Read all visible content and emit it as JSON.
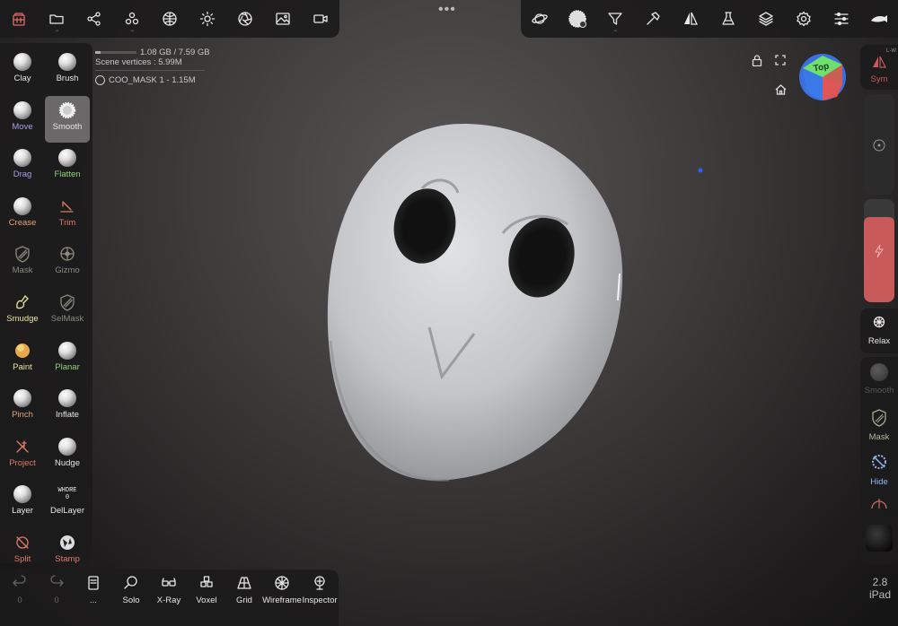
{
  "topbar_left": {
    "icons": [
      "app-logo-icon",
      "folder-icon",
      "share-icon",
      "scene-icon",
      "globe-icon",
      "sun-icon",
      "aperture-icon",
      "image-icon",
      "camera-icon"
    ]
  },
  "topbar_right": {
    "icons": [
      "planet-icon",
      "brush-sphere-icon",
      "filter-icon",
      "hammer-icon",
      "symmetry-icon",
      "flask-icon",
      "layers-icon",
      "gear-icon",
      "sliders-icon",
      "fish-icon"
    ]
  },
  "scene_info": {
    "memory": "1.08 GB / 7.59 GB",
    "memory_fraction": 0.14,
    "vertices": "Scene vertices : 5.99M",
    "object": "COO_MASK 1 - 1.15M"
  },
  "tools": [
    {
      "label": "Clay",
      "color": "#e6e6e6",
      "icon": "sphere"
    },
    {
      "label": "Brush",
      "color": "#e6e6e6",
      "icon": "sphere"
    },
    {
      "label": "Move",
      "color": "#a9a0e8",
      "icon": "sphere"
    },
    {
      "label": "Smooth",
      "color": "#e6e6e6",
      "icon": "spiky",
      "active": true
    },
    {
      "label": "Drag",
      "color": "#a9a0e8",
      "icon": "sphere"
    },
    {
      "label": "Flatten",
      "color": "#8fd17a",
      "icon": "sphere"
    },
    {
      "label": "Crease",
      "color": "#e2a276",
      "icon": "sphere"
    },
    {
      "label": "Trim",
      "color": "#e07a6a",
      "icon": "trim"
    },
    {
      "label": "Mask",
      "color": "#8a8a7e",
      "icon": "shield"
    },
    {
      "label": "Gizmo",
      "color": "#8a8a7e",
      "icon": "gizmo"
    },
    {
      "label": "Smudge",
      "color": "#e8e3a0",
      "icon": "smudge"
    },
    {
      "label": "SelMask",
      "color": "#8a8a7e",
      "icon": "shield"
    },
    {
      "label": "Paint",
      "color": "#e8e3a0",
      "icon": "paint"
    },
    {
      "label": "Planar",
      "color": "#8fd17a",
      "icon": "sphere"
    },
    {
      "label": "Pinch",
      "color": "#e2a276",
      "icon": "sphere"
    },
    {
      "label": "Inflate",
      "color": "#e6e6e6",
      "icon": "sphere"
    },
    {
      "label": "Project",
      "color": "#e07a6a",
      "icon": "project"
    },
    {
      "label": "Nudge",
      "color": "#e6e6e6",
      "icon": "sphere"
    },
    {
      "label": "Layer",
      "color": "#e6e6e6",
      "icon": "sphere"
    },
    {
      "label": "DelLayer",
      "color": "#e6e6e6",
      "icon": "text-icon"
    },
    {
      "label": "Split",
      "color": "#e07a6a",
      "icon": "split"
    },
    {
      "label": "Stamp",
      "color": "#e07a6a",
      "icon": "stamp"
    }
  ],
  "dellayer_icon_text": "WHDRE\n0",
  "bottombar": [
    {
      "label": "0",
      "icon": "undo-icon",
      "dim": true
    },
    {
      "label": "0",
      "icon": "redo-icon",
      "dim": true
    },
    {
      "label": "...",
      "icon": "book-icon",
      "dim": false
    },
    {
      "label": "Solo",
      "icon": "search-icon",
      "dim": false
    },
    {
      "label": "X-Ray",
      "icon": "glasses-icon",
      "dim": false
    },
    {
      "label": "Voxel",
      "icon": "voxel-icon",
      "dim": false
    },
    {
      "label": "Grid",
      "icon": "grid-icon",
      "dim": false
    },
    {
      "label": "Wireframe",
      "icon": "wireframe-icon",
      "dim": false
    },
    {
      "label": "Inspector",
      "icon": "inspector-icon",
      "dim": false
    }
  ],
  "right": {
    "sym_label": "Sym",
    "sym_sub": "L-W",
    "relax_label": "Relax",
    "quick": [
      {
        "label": "Smooth",
        "dim": true
      },
      {
        "label": "Mask",
        "dim": false
      },
      {
        "label": "Hide",
        "dim": false
      }
    ],
    "intensity_fraction": 0.83
  },
  "view_cube_label": "Top",
  "version": "2.8\niPad",
  "colors": {
    "accent_red": "#c85a5a",
    "hide_blue": "#8fb4f0"
  }
}
